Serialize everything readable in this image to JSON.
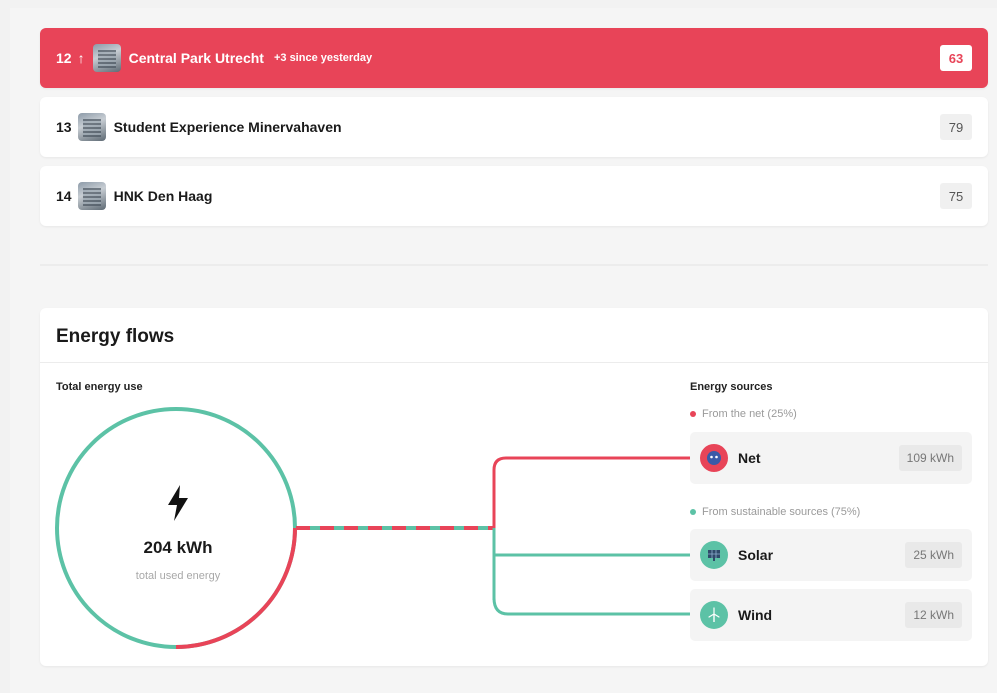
{
  "ranking": {
    "rows": [
      {
        "rank": "12",
        "arrow": "↑",
        "name": "Central Park Utrecht",
        "change": "+3 since yesterday",
        "score": "63"
      },
      {
        "rank": "13",
        "arrow": "",
        "name": "Student Experience Minervahaven",
        "change": "",
        "score": "79"
      },
      {
        "rank": "14",
        "arrow": "",
        "name": "HNK Den Haag",
        "change": "",
        "score": "75"
      }
    ]
  },
  "energy": {
    "title": "Energy flows",
    "total_heading": "Total energy use",
    "total_value": "204 kWh",
    "total_caption": "total used energy",
    "sources_heading": "Energy sources",
    "from_net_label": "From the net (25%)",
    "from_sustainable_label": "From sustainable sources (75%)",
    "net_fraction": 0.25,
    "sources": [
      {
        "name": "Net",
        "value": "109 kWh",
        "icon": "plug-icon",
        "color": "#e84458"
      },
      {
        "name": "Solar",
        "value": "25 kWh",
        "icon": "solar-panel-icon",
        "color": "#5cc2a6"
      },
      {
        "name": "Wind",
        "value": "12 kWh",
        "icon": "wind-turbine-icon",
        "color": "#5cc2a6"
      }
    ]
  },
  "colors": {
    "accent_red": "#e84458",
    "accent_teal": "#5cc2a6"
  }
}
